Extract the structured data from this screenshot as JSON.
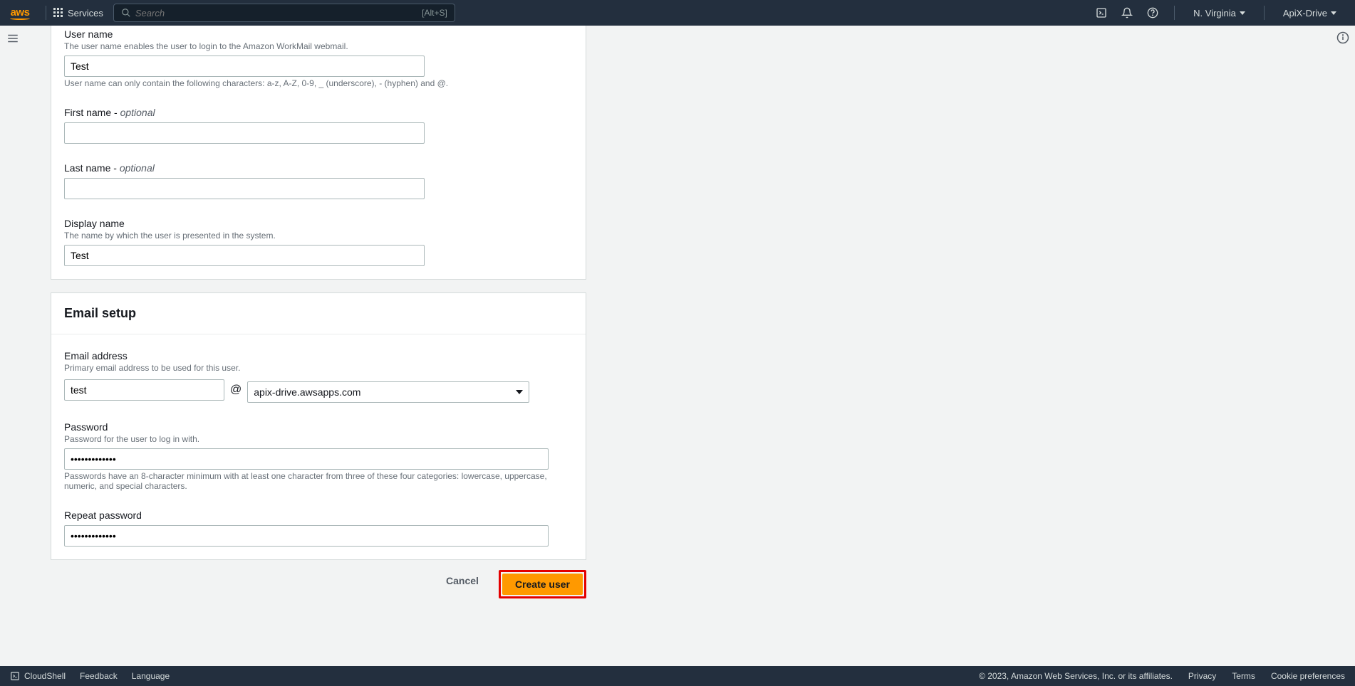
{
  "topnav": {
    "services_label": "Services",
    "search_placeholder": "Search",
    "search_shortcut": "[Alt+S]",
    "region": "N. Virginia",
    "account": "ApiX-Drive"
  },
  "form": {
    "username": {
      "label": "User name",
      "help": "The user name enables the user to login to the Amazon WorkMail webmail.",
      "value": "Test",
      "constraint": "User name can only contain the following characters: a-z, A-Z, 0-9, _ (underscore), - (hyphen) and @."
    },
    "firstname": {
      "label": "First name - ",
      "optional": "optional",
      "value": ""
    },
    "lastname": {
      "label": "Last name - ",
      "optional": "optional",
      "value": ""
    },
    "displayname": {
      "label": "Display name",
      "help": "The name by which the user is presented in the system.",
      "value": "Test"
    },
    "email_setup_title": "Email setup",
    "email": {
      "label": "Email address",
      "help": "Primary email address to be used for this user.",
      "local": "test",
      "at": "@",
      "domain": "apix-drive.awsapps.com"
    },
    "password": {
      "label": "Password",
      "help": "Password for the user to log in with.",
      "value": "•••••••••••••",
      "constraint": "Passwords have an 8-character minimum with at least one character from three of these four categories: lowercase, uppercase, numeric, and special characters."
    },
    "repeat_password": {
      "label": "Repeat password",
      "value": "•••••••••••••"
    }
  },
  "actions": {
    "cancel": "Cancel",
    "create": "Create user"
  },
  "footer": {
    "cloudshell": "CloudShell",
    "feedback": "Feedback",
    "language": "Language",
    "copyright": "© 2023, Amazon Web Services, Inc. or its affiliates.",
    "privacy": "Privacy",
    "terms": "Terms",
    "cookie": "Cookie preferences"
  }
}
